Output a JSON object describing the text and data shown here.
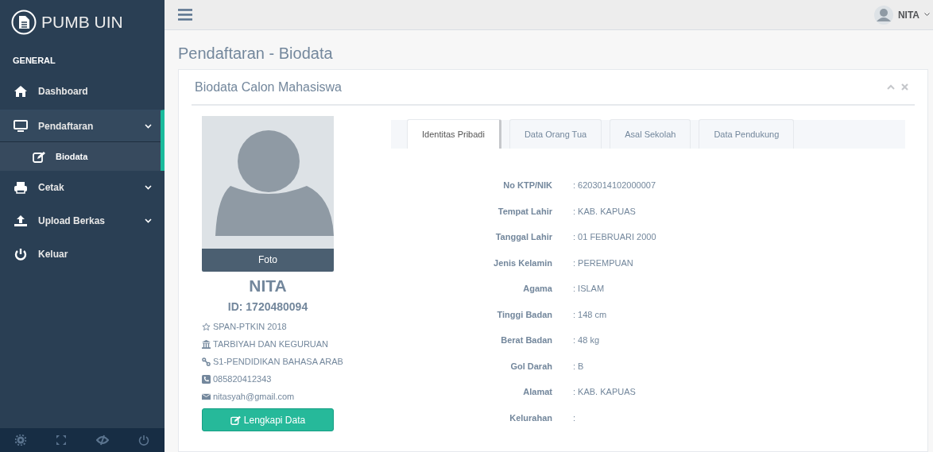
{
  "brand": "PUMB UIN",
  "sidebar": {
    "section": "GENERAL",
    "items": [
      {
        "label": "Dashboard"
      },
      {
        "label": "Pendaftaran",
        "expanded": true,
        "children": [
          {
            "label": "Biodata",
            "selected": true
          }
        ]
      },
      {
        "label": "Cetak",
        "expanded": false
      },
      {
        "label": "Upload Berkas",
        "expanded": false
      },
      {
        "label": "Keluar"
      }
    ]
  },
  "user": {
    "name": "NITA"
  },
  "page_title": "Pendaftaran - Biodata",
  "panel": {
    "title": "Biodata Calon Mahasiswa",
    "profile": {
      "photo_label": "Foto",
      "name": "NITA",
      "id": "ID: 1720480094",
      "info": [
        "SPAN-PTKIN 2018",
        "TARBIYAH DAN KEGURUAN",
        "S1-PENDIDIKAN BAHASA ARAB",
        "085820412343",
        "nitasyah@gmail.com"
      ],
      "button": "Lengkapi Data"
    },
    "tabs": [
      {
        "label": "Identitas Pribadi",
        "selected": true
      },
      {
        "label": "Data Orang Tua",
        "selected": false
      },
      {
        "label": "Asal Sekolah",
        "selected": false
      },
      {
        "label": "Data Pendukung",
        "selected": false
      }
    ],
    "fields": [
      {
        "label": "No KTP/NIK",
        "value": ": 6203014102000007"
      },
      {
        "label": "Tempat Lahir",
        "value": ": KAB. KAPUAS"
      },
      {
        "label": "Tanggal Lahir",
        "value": ": 01 FEBRUARI 2000"
      },
      {
        "label": "Jenis Kelamin",
        "value": ": PEREMPUAN"
      },
      {
        "label": "Agama",
        "value": ": ISLAM"
      },
      {
        "label": "Tinggi Badan",
        "value": ": 148 cm"
      },
      {
        "label": "Berat Badan",
        "value": ": 48 kg"
      },
      {
        "label": "Gol Darah",
        "value": ": B"
      },
      {
        "label": "Alamat",
        "value": ": KAB. KAPUAS"
      },
      {
        "label": "Kelurahan",
        "value": ":"
      }
    ]
  }
}
